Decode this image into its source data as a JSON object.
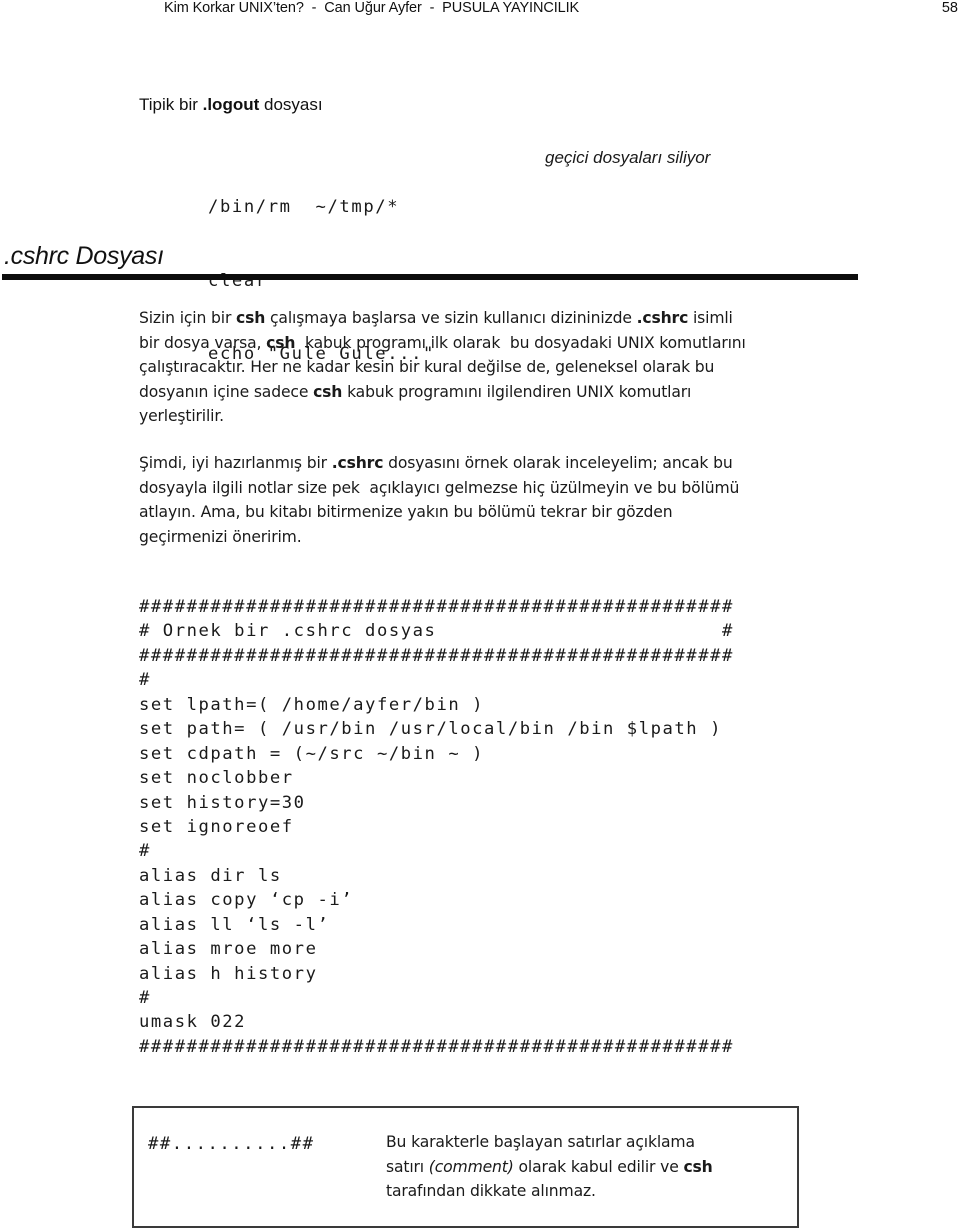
{
  "header": {
    "running_title": "Kim Korkar UNIX’ten?  -  Can Uğur Ayfer  -  PUSULA YAYINCILIK",
    "page_number": "58"
  },
  "logout_section": {
    "title_prefix": "Tipik bir ",
    "title_bold": ".logout",
    "title_suffix": " dosyası",
    "code_lines": [
      "/bin/rm  ~/tmp/*",
      "clear",
      "echo \"Gule Gule...\""
    ],
    "note": "geçici dosyaları siliyor"
  },
  "cshrc_section": {
    "heading": ".cshrc Dosyası",
    "paragraph1": {
      "l1_a": "Sizin için bir ",
      "l1_b": "csh",
      "l1_c": " çalışmaya başlarsa ve sizin kullanıcı dizininizde ",
      "l1_d": ".cshrc",
      "l1_e": " isimli",
      "l2_a": "bir dosya varsa, ",
      "l2_b": "csh",
      "l2_c": "  kabuk programı ilk olarak  bu dosyadaki UNIX komutlarını",
      "l3": "çalıştıracaktır. Her ne kadar kesin bir kural değilse de, geleneksel olarak bu",
      "l4_a": "dosyanın içine sadece ",
      "l4_b": "csh",
      "l4_c": " kabuk programını ilgilendiren UNIX komutları",
      "l5": "yerleştirilir."
    },
    "paragraph2": {
      "l1_a": "Şimdi, iyi hazırlanmış bir ",
      "l1_b": ".cshrc",
      "l1_c": " dosyasını örnek olarak inceleyelim; ancak bu",
      "l2": "dosyayla ilgili notlar size pek  açıklayıcı gelmezse hiç üzülmeyin ve bu bölümü",
      "l3": "atlayın. Ama, bu kitabı bitirmenize yakın bu bölümü tekrar bir gözden",
      "l4": "geçirmenizi öneririm."
    },
    "code_lines": [
      "##################################################",
      "# Ornek bir .cshrc dosyas                        #",
      "##################################################",
      "#",
      "set lpath=( /home/ayfer/bin )",
      "set path= ( /usr/bin /usr/local/bin /bin $lpath )",
      "set cdpath = (~/src ~/bin ~ )",
      "set noclobber",
      "set history=30",
      "set ignoreoef",
      "#",
      "alias dir ls",
      "alias copy ‘cp -i’",
      "alias ll ‘ls -l’",
      "alias mroe more",
      "alias h history",
      "#",
      "umask 022",
      "##################################################"
    ]
  },
  "comment_box": {
    "marker": "##..........##",
    "l1": "Bu karakterle başlayan satırlar açıklama",
    "l2_a": "satırı ",
    "l2_b": "(comment)",
    "l2_c": " olarak kabul edilir ve ",
    "l2_d": "csh",
    "l3": "tarafından dikkate alınmaz."
  }
}
